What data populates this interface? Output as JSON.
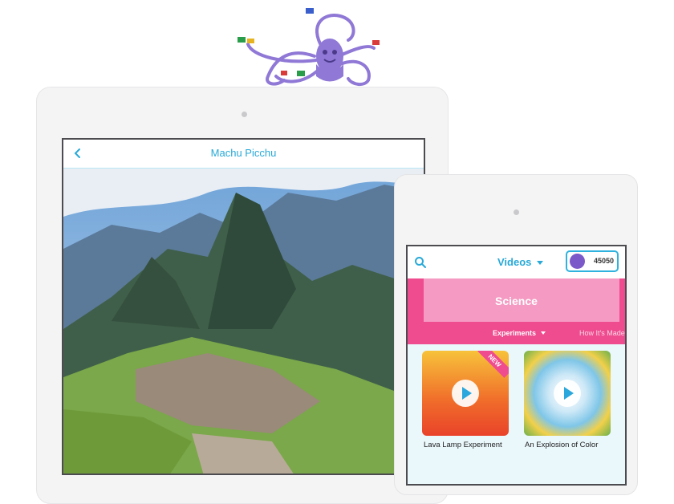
{
  "large_tablet": {
    "title": "Machu Picchu"
  },
  "small_tablet": {
    "section_title": "Videos",
    "coins": "45050",
    "banner": {
      "title": "Science",
      "active_tab": "Experiments",
      "next_tab": "How It's Made"
    },
    "cards": [
      {
        "title": "Lava Lamp Experiment",
        "badge": "NEW"
      },
      {
        "title": "An Explosion of Color"
      }
    ]
  },
  "colors": {
    "accent": "#28a9d8",
    "banner_pink": "#ef4b8f",
    "mascot_purple": "#8f78d6"
  },
  "icons": [
    "octopus-mascot",
    "back-chevron-icon",
    "search-icon",
    "play-icon",
    "avatar-icon"
  ]
}
